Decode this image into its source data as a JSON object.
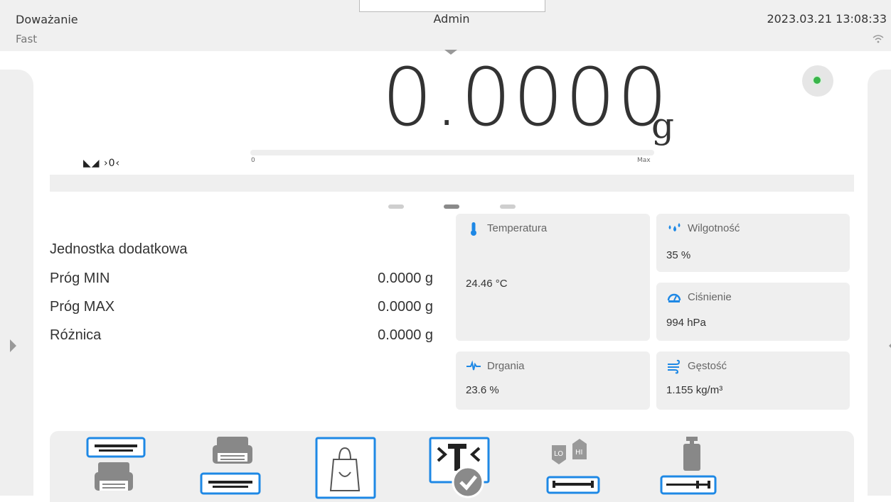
{
  "header": {
    "mode": "Doważanie",
    "profile": "Fast",
    "user": "Admin",
    "datetime": "2023.03.21 13:08:33"
  },
  "weighing": {
    "value": "0.0000",
    "unit": "g",
    "stability_icons": "◣◢ ›0‹",
    "bargraph_min_label": "0",
    "bargraph_max_label": "Max",
    "status_color": "#39b54a"
  },
  "pages": {
    "count": 3,
    "active": 2
  },
  "info_panel": {
    "title": "Jednostka dodatkowa",
    "rows": [
      {
        "label": "Próg MIN",
        "value": "0.0000 g"
      },
      {
        "label": "Próg MAX",
        "value": "0.0000 g"
      },
      {
        "label": "Różnica",
        "value": "0.0000 g"
      }
    ]
  },
  "sensors": {
    "temperature": {
      "label": "Temperatura",
      "value": "24.46 °C",
      "icon": "thermometer-icon"
    },
    "humidity": {
      "label": "Wilgotność",
      "value": "35 %",
      "icon": "droplets-icon"
    },
    "pressure": {
      "label": "Ciśnienie",
      "value": "994 hPa",
      "icon": "gauge-icon"
    },
    "vibration": {
      "label": "Drgania",
      "value": "23.6 %",
      "icon": "vibration-icon"
    },
    "density": {
      "label": "Gęstość",
      "value": "1.155 kg/m³",
      "icon": "wind-icon"
    }
  },
  "toolbar": {
    "buttons": [
      {
        "name": "print-header-button",
        "icon": "print-header-icon"
      },
      {
        "name": "print-footer-button",
        "icon": "print-footer-icon"
      },
      {
        "name": "tare-database-button",
        "icon": "bag-icon"
      },
      {
        "name": "tare-button",
        "icon": "tare-icon"
      },
      {
        "name": "thresholds-button",
        "icon": "lo-hi-icon"
      },
      {
        "name": "adjustment-button",
        "icon": "weight-adjust-icon"
      }
    ]
  },
  "colors": {
    "accent_blue": "#1e88e5",
    "status_green": "#39b54a",
    "panel_gray": "#efefef"
  }
}
